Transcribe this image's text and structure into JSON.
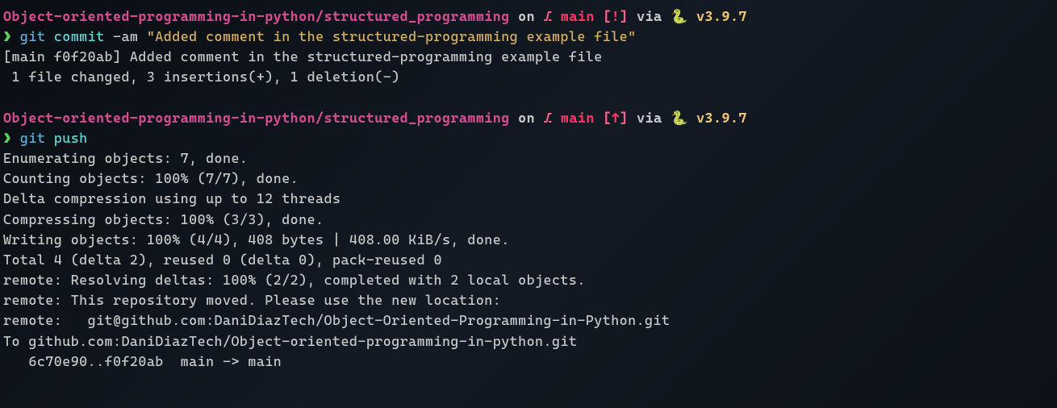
{
  "prompt1": {
    "path": "Object-oriented-programming-in-python/structured_programming",
    "on": " on ",
    "branch_icon": "⎇",
    "branch": " main ",
    "bracket_open": "[",
    "status": "!",
    "bracket_close": "]",
    "via": " via ",
    "snake": "🐍 ",
    "version": "v3.9.7"
  },
  "cmd1": {
    "arrow": "❯ ",
    "git": "git ",
    "sub": "commit ",
    "flag": "-am ",
    "msg": "\"Added comment in the structured-programming example file\""
  },
  "out1": {
    "line1": "[main f0f20ab] Added comment in the structured-programming example file",
    "line2": " 1 file changed, 3 insertions(+), 1 deletion(-)"
  },
  "prompt2": {
    "path": "Object-oriented-programming-in-python/structured_programming",
    "on": " on ",
    "branch_icon": "⎇",
    "branch": " main ",
    "bracket_open": "[",
    "status": "↑",
    "bracket_close": "]",
    "via": " via ",
    "snake": "🐍 ",
    "version": "v3.9.7"
  },
  "cmd2": {
    "arrow": "❯ ",
    "git": "git ",
    "sub": "push"
  },
  "out2": {
    "l1": "Enumerating objects: 7, done.",
    "l2": "Counting objects: 100% (7/7), done.",
    "l3": "Delta compression using up to 12 threads",
    "l4": "Compressing objects: 100% (3/3), done.",
    "l5": "Writing objects: 100% (4/4), 408 bytes | 408.00 KiB/s, done.",
    "l6": "Total 4 (delta 2), reused 0 (delta 0), pack-reused 0",
    "l7": "remote: Resolving deltas: 100% (2/2), completed with 2 local objects.",
    "l8": "remote: This repository moved. Please use the new location:",
    "l9": "remote:   git@github.com:DaniDiazTech/Object-Oriented-Programming-in-Python.git",
    "l10": "To github.com:DaniDiazTech/Object-oriented-programming-in-python.git",
    "l11": "   6c70e90..f0f20ab  main -> main"
  }
}
